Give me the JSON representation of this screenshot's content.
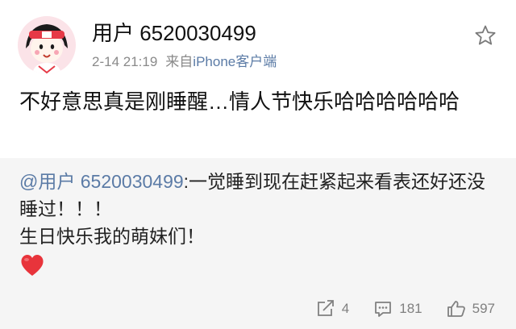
{
  "post": {
    "username": "用户 6520030499",
    "timestamp": "2-14 21:19",
    "source_prefix": "来自",
    "source_name": "iPhone客户端",
    "text": "不好意思真是刚睡醒…情人节快乐哈哈哈哈哈哈",
    "favorite_icon": "star-outline-icon"
  },
  "retweet": {
    "mention": "@用户 6520030499",
    "text": ":一觉睡到现在赶紧起来看表还好还没睡过！！！\n生日快乐我的萌妹们！",
    "emoji": "heart-icon",
    "emoji_color": "#e8343b"
  },
  "actions": {
    "repost_count": "4",
    "comment_count": "181",
    "like_count": "597"
  },
  "colors": {
    "link": "#5b7ba6",
    "meta": "#8a8a8a",
    "action": "#808080",
    "retweet_background": "#f5f5f5"
  }
}
